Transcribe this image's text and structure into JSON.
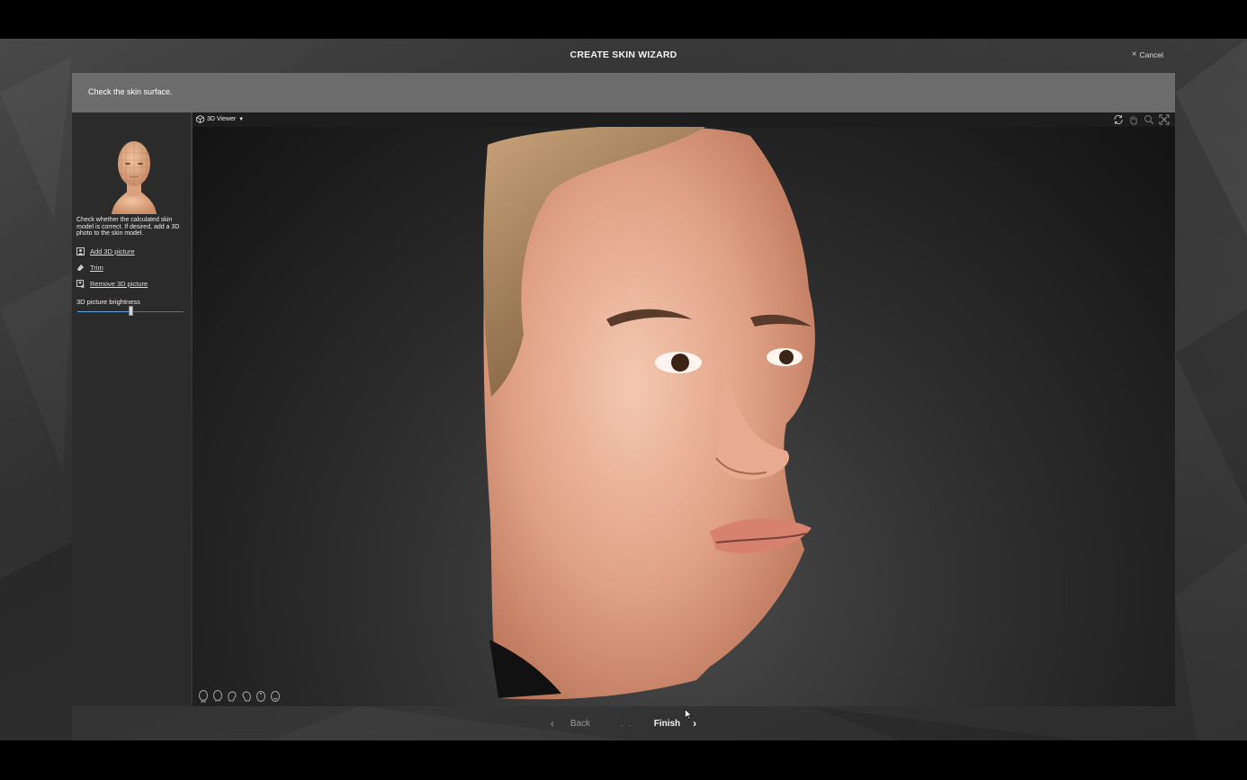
{
  "wizard": {
    "title": "CREATE SKIN WIZARD",
    "cancel_label": "Cancel"
  },
  "instruction": {
    "text": "Check the skin surface."
  },
  "panel": {
    "description": "Check whether the calculated skin model is correct. If desired, add a 3D photo to the skin model.",
    "links": [
      {
        "label": "Add 3D picture",
        "icon": "add-picture-icon"
      },
      {
        "label": "Trim",
        "icon": "eraser-icon"
      },
      {
        "label": "Remove 3D picture",
        "icon": "remove-picture-icon"
      }
    ],
    "brightness": {
      "label": "3D picture brightness",
      "value": 0.5
    }
  },
  "viewer": {
    "mode_label": "3D Viewer",
    "tools": [
      "rotate-icon",
      "pan-hand-icon",
      "zoom-icon",
      "fit-view-icon"
    ],
    "presets": [
      "front-view-icon",
      "back-view-icon",
      "left-view-icon",
      "right-view-icon",
      "top-view-icon",
      "bottom-view-icon"
    ]
  },
  "footer": {
    "back_label": "Back",
    "finish_label": "Finish",
    "dots": ". ."
  },
  "colors": {
    "accent": "#6aa4d8",
    "instruction_bar": "#6c6c6c",
    "panel_bg": "#2b2b2b"
  }
}
